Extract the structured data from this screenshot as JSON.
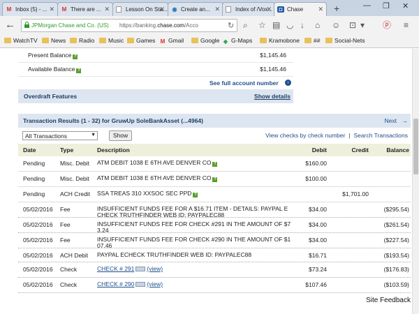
{
  "browser": {
    "tabs": [
      {
        "icon": "gmail-icon",
        "glyph": "M",
        "title": "Inbox (5) - ...",
        "active": false
      },
      {
        "icon": "gmail-icon",
        "glyph": "M",
        "title": "There are ...",
        "active": false
      },
      {
        "icon": "blank-page-icon",
        "glyph": "",
        "title": "Lesson On Sta...",
        "active": false
      },
      {
        "icon": "globe-icon",
        "glyph": "◉",
        "title": "Create an...",
        "active": false
      },
      {
        "icon": "blank-page-icon",
        "glyph": "",
        "title": "Index of /Vox...",
        "active": false
      },
      {
        "icon": "chase-icon",
        "glyph": "◘",
        "title": "Chase",
        "active": true
      }
    ],
    "url_owner": "JPMorgan Chase and Co. (US)",
    "url_prefix": "https://banking.",
    "url_domain": "chase.com",
    "url_suffix": "/Acco"
  },
  "bookmarks": [
    {
      "label": "WatchTV",
      "kind": "folder"
    },
    {
      "label": "News",
      "kind": "folder"
    },
    {
      "label": "Radio",
      "kind": "folder"
    },
    {
      "label": "Music",
      "kind": "folder"
    },
    {
      "label": "Games",
      "kind": "folder"
    },
    {
      "label": "Gmail",
      "kind": "gmail"
    },
    {
      "label": "Google",
      "kind": "folder"
    },
    {
      "label": "G-Maps",
      "kind": "maps"
    },
    {
      "label": "Kramobone",
      "kind": "folder"
    },
    {
      "label": "##",
      "kind": "folder"
    },
    {
      "label": "Social-Nets",
      "kind": "folder"
    }
  ],
  "balances": [
    {
      "label": "Present Balance",
      "help": true,
      "value": "$1,145.46"
    },
    {
      "label": "Available Balance",
      "help": true,
      "value": "$1,145.46"
    }
  ],
  "see_full": "See full account number",
  "overdraft": {
    "title": "Overdraft Features",
    "link": "Show details"
  },
  "transactions": {
    "title": "Transaction Results (1 - 32) for GruwUp SoleBankAsset (...4964)",
    "next": "Next",
    "filter_value": "All Transactions",
    "show_button": "Show",
    "view_checks": "View checks by check number",
    "separator": "|",
    "search": "Search Transactions",
    "headers": {
      "date": "Date",
      "type": "Type",
      "description": "Description",
      "debit": "Debit",
      "credit": "Credit",
      "balance": "Balance"
    },
    "rows": [
      {
        "date": "Pending",
        "type": "Misc. Debit",
        "desc1": "ATM DEBIT 1038 E 6TH AVE DENVER CO",
        "desc2": "",
        "help": true,
        "debit": "$160.00",
        "credit": "",
        "balance": "",
        "check": false
      },
      {
        "date": "Pending",
        "type": "Misc. Debit",
        "desc1": "ATM DEBIT 1038 E 6TH AVE DENVER CO",
        "desc2": "",
        "help": true,
        "debit": "$100.00",
        "credit": "",
        "balance": "",
        "check": false
      },
      {
        "date": "Pending",
        "type": "ACH Credit",
        "desc1": "SSA TREAS 310 XXSOC SEC PPD",
        "desc2": "",
        "help": true,
        "debit": "",
        "credit": "$1,701.00",
        "balance": "",
        "check": false
      },
      {
        "date": "05/02/2016",
        "type": "Fee",
        "desc1": "INSUFFICIENT FUNDS FEE FOR A $16.71 ITEM - DETAILS: PAYPAL E",
        "desc2": "CHECK TRUTHFINDER WEB ID: PAYPALEC88",
        "help": false,
        "debit": "$34.00",
        "credit": "",
        "balance": "($295.54)",
        "check": false
      },
      {
        "date": "05/02/2016",
        "type": "Fee",
        "desc1": "INSUFFICIENT FUNDS FEE FOR CHECK #291 IN THE AMOUNT OF $7",
        "desc2": "3.24",
        "help": false,
        "debit": "$34.00",
        "credit": "",
        "balance": "($261.54)",
        "check": false
      },
      {
        "date": "05/02/2016",
        "type": "Fee",
        "desc1": "INSUFFICIENT FUNDS FEE FOR CHECK #290 IN THE AMOUNT OF $1",
        "desc2": "07.46",
        "help": false,
        "debit": "$34.00",
        "credit": "",
        "balance": "($227.54)",
        "check": false
      },
      {
        "date": "05/02/2016",
        "type": "ACH Debit",
        "desc1": "PAYPAL ECHECK TRUTHFINDER WEB ID: PAYPALEC88",
        "desc2": "",
        "help": false,
        "debit": "$16.71",
        "credit": "",
        "balance": "($193.54)",
        "check": false
      },
      {
        "date": "05/02/2016",
        "type": "Check",
        "desc1": "CHECK # 291",
        "desc2": "",
        "help": false,
        "debit": "$73.24",
        "credit": "",
        "balance": "($176.83)",
        "check": true,
        "view": "(view)"
      },
      {
        "date": "05/02/2016",
        "type": "Check",
        "desc1": "CHECK # 290",
        "desc2": "",
        "help": false,
        "debit": "$107.46",
        "credit": "",
        "balance": "($103.59)",
        "check": true,
        "view": "(view)"
      }
    ]
  },
  "site_feedback": "Site Feedback",
  "colors": {
    "link": "#1f4e8c",
    "section_bar": "#dde6f0",
    "header_bar": "#eef0dc",
    "secure_green": "#2c9a2c"
  }
}
